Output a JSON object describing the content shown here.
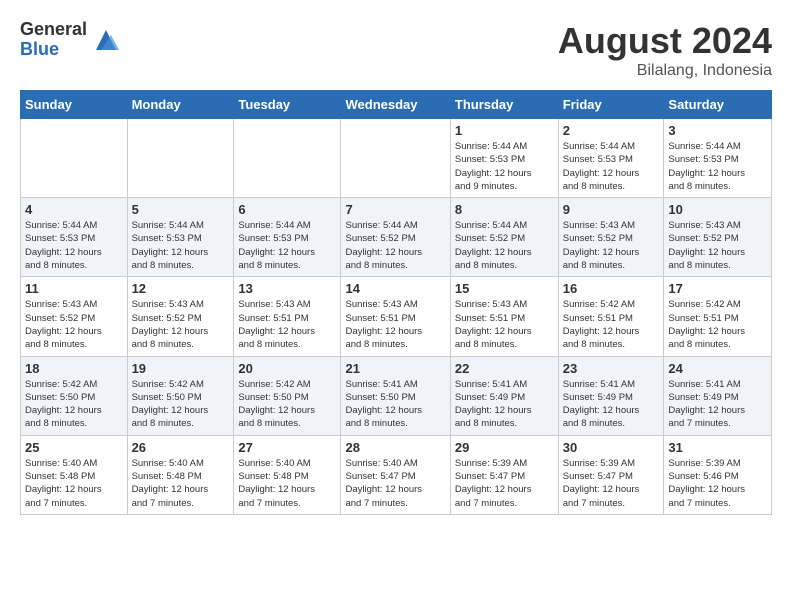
{
  "logo": {
    "general": "General",
    "blue": "Blue"
  },
  "title": {
    "month": "August 2024",
    "location": "Bilalang, Indonesia"
  },
  "weekdays": [
    "Sunday",
    "Monday",
    "Tuesday",
    "Wednesday",
    "Thursday",
    "Friday",
    "Saturday"
  ],
  "weeks": [
    [
      {
        "day": "",
        "info": ""
      },
      {
        "day": "",
        "info": ""
      },
      {
        "day": "",
        "info": ""
      },
      {
        "day": "",
        "info": ""
      },
      {
        "day": "1",
        "info": "Sunrise: 5:44 AM\nSunset: 5:53 PM\nDaylight: 12 hours\nand 9 minutes."
      },
      {
        "day": "2",
        "info": "Sunrise: 5:44 AM\nSunset: 5:53 PM\nDaylight: 12 hours\nand 8 minutes."
      },
      {
        "day": "3",
        "info": "Sunrise: 5:44 AM\nSunset: 5:53 PM\nDaylight: 12 hours\nand 8 minutes."
      }
    ],
    [
      {
        "day": "4",
        "info": "Sunrise: 5:44 AM\nSunset: 5:53 PM\nDaylight: 12 hours\nand 8 minutes."
      },
      {
        "day": "5",
        "info": "Sunrise: 5:44 AM\nSunset: 5:53 PM\nDaylight: 12 hours\nand 8 minutes."
      },
      {
        "day": "6",
        "info": "Sunrise: 5:44 AM\nSunset: 5:53 PM\nDaylight: 12 hours\nand 8 minutes."
      },
      {
        "day": "7",
        "info": "Sunrise: 5:44 AM\nSunset: 5:52 PM\nDaylight: 12 hours\nand 8 minutes."
      },
      {
        "day": "8",
        "info": "Sunrise: 5:44 AM\nSunset: 5:52 PM\nDaylight: 12 hours\nand 8 minutes."
      },
      {
        "day": "9",
        "info": "Sunrise: 5:43 AM\nSunset: 5:52 PM\nDaylight: 12 hours\nand 8 minutes."
      },
      {
        "day": "10",
        "info": "Sunrise: 5:43 AM\nSunset: 5:52 PM\nDaylight: 12 hours\nand 8 minutes."
      }
    ],
    [
      {
        "day": "11",
        "info": "Sunrise: 5:43 AM\nSunset: 5:52 PM\nDaylight: 12 hours\nand 8 minutes."
      },
      {
        "day": "12",
        "info": "Sunrise: 5:43 AM\nSunset: 5:52 PM\nDaylight: 12 hours\nand 8 minutes."
      },
      {
        "day": "13",
        "info": "Sunrise: 5:43 AM\nSunset: 5:51 PM\nDaylight: 12 hours\nand 8 minutes."
      },
      {
        "day": "14",
        "info": "Sunrise: 5:43 AM\nSunset: 5:51 PM\nDaylight: 12 hours\nand 8 minutes."
      },
      {
        "day": "15",
        "info": "Sunrise: 5:43 AM\nSunset: 5:51 PM\nDaylight: 12 hours\nand 8 minutes."
      },
      {
        "day": "16",
        "info": "Sunrise: 5:42 AM\nSunset: 5:51 PM\nDaylight: 12 hours\nand 8 minutes."
      },
      {
        "day": "17",
        "info": "Sunrise: 5:42 AM\nSunset: 5:51 PM\nDaylight: 12 hours\nand 8 minutes."
      }
    ],
    [
      {
        "day": "18",
        "info": "Sunrise: 5:42 AM\nSunset: 5:50 PM\nDaylight: 12 hours\nand 8 minutes."
      },
      {
        "day": "19",
        "info": "Sunrise: 5:42 AM\nSunset: 5:50 PM\nDaylight: 12 hours\nand 8 minutes."
      },
      {
        "day": "20",
        "info": "Sunrise: 5:42 AM\nSunset: 5:50 PM\nDaylight: 12 hours\nand 8 minutes."
      },
      {
        "day": "21",
        "info": "Sunrise: 5:41 AM\nSunset: 5:50 PM\nDaylight: 12 hours\nand 8 minutes."
      },
      {
        "day": "22",
        "info": "Sunrise: 5:41 AM\nSunset: 5:49 PM\nDaylight: 12 hours\nand 8 minutes."
      },
      {
        "day": "23",
        "info": "Sunrise: 5:41 AM\nSunset: 5:49 PM\nDaylight: 12 hours\nand 8 minutes."
      },
      {
        "day": "24",
        "info": "Sunrise: 5:41 AM\nSunset: 5:49 PM\nDaylight: 12 hours\nand 7 minutes."
      }
    ],
    [
      {
        "day": "25",
        "info": "Sunrise: 5:40 AM\nSunset: 5:48 PM\nDaylight: 12 hours\nand 7 minutes."
      },
      {
        "day": "26",
        "info": "Sunrise: 5:40 AM\nSunset: 5:48 PM\nDaylight: 12 hours\nand 7 minutes."
      },
      {
        "day": "27",
        "info": "Sunrise: 5:40 AM\nSunset: 5:48 PM\nDaylight: 12 hours\nand 7 minutes."
      },
      {
        "day": "28",
        "info": "Sunrise: 5:40 AM\nSunset: 5:47 PM\nDaylight: 12 hours\nand 7 minutes."
      },
      {
        "day": "29",
        "info": "Sunrise: 5:39 AM\nSunset: 5:47 PM\nDaylight: 12 hours\nand 7 minutes."
      },
      {
        "day": "30",
        "info": "Sunrise: 5:39 AM\nSunset: 5:47 PM\nDaylight: 12 hours\nand 7 minutes."
      },
      {
        "day": "31",
        "info": "Sunrise: 5:39 AM\nSunset: 5:46 PM\nDaylight: 12 hours\nand 7 minutes."
      }
    ]
  ]
}
